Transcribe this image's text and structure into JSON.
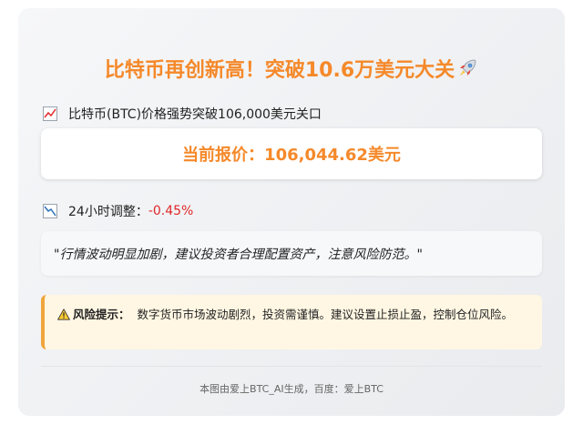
{
  "card": {
    "title": "比特币再创新高！突破10.6万美元大关",
    "title_icon": "rocket-icon",
    "headline": {
      "icon": "chart-up-icon",
      "text": "比特币(BTC)价格强势突破106,000美元关口"
    },
    "price": {
      "text": "当前报价：106,044.62美元"
    },
    "change": {
      "icon": "chart-down-icon",
      "label": "24小时调整：",
      "value": "-0.45%"
    },
    "quote": "\"行情波动明显加剧，建议投资者合理配置资产，注意风险防范。\"",
    "risk": {
      "icon": "warning-icon",
      "label": "风险提示：",
      "text": "数字货币市场波动剧烈，投资需谨慎。建议设置止损止盈，控制仓位风险。"
    },
    "footer": "本图由爱上BTC_AI生成，百度：爱上BTC"
  },
  "colors": {
    "accent": "#f5892a",
    "negative": "#e0282a",
    "warning_border": "#f0a63c",
    "warning_bg": "#fff7e3"
  }
}
